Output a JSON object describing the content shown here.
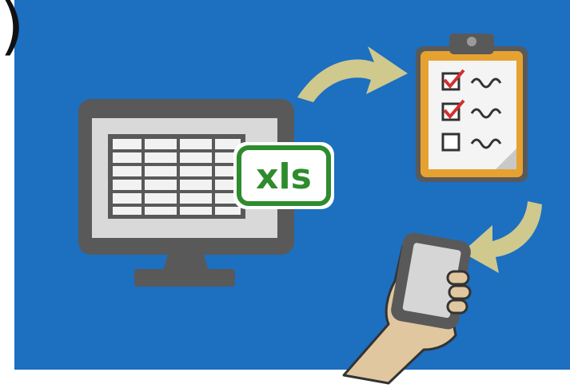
{
  "badge": {
    "text": "xls"
  },
  "edge_glyph": ")",
  "colors": {
    "background": "#1d6fc0",
    "arrow": "#cfc98e",
    "monitor": "#595959",
    "badge_green": "#2e8b2e",
    "clipboard": "#e6a230",
    "check_red": "#d32f2f",
    "hand": "#e0c79f"
  },
  "icons": [
    "monitor-icon",
    "spreadsheet-icon",
    "xls-badge",
    "clipboard-icon",
    "checklist-icon",
    "smartphone-icon",
    "hand-icon",
    "arrow-icon"
  ]
}
